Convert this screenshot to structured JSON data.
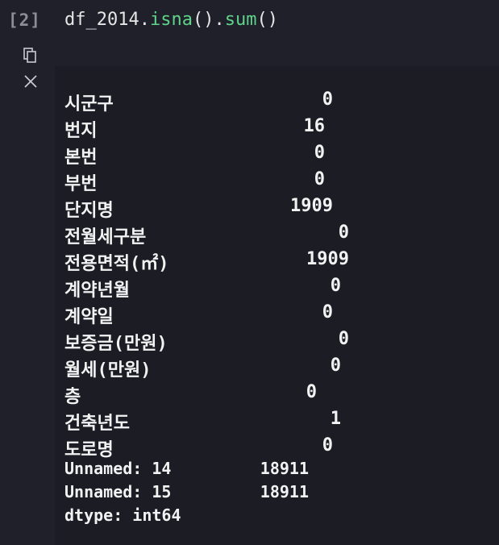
{
  "cell": {
    "prompt": "[2]",
    "code": {
      "obj": "df_2014.",
      "fn1": "isna",
      "mid": "().",
      "fn2": "sum",
      "end": "()"
    }
  },
  "output": {
    "rows": [
      {
        "label": "시군구",
        "value": "0"
      },
      {
        "label": "번지",
        "value": "16"
      },
      {
        "label": "본번",
        "value": "0"
      },
      {
        "label": "부번",
        "value": "0"
      },
      {
        "label": "단지명",
        "value": "1909"
      },
      {
        "label": "전월세구분",
        "value": "0"
      },
      {
        "label": "전용면적(㎡)",
        "value": "1909"
      },
      {
        "label": "계약년월",
        "value": "0"
      },
      {
        "label": "계약일",
        "value": "0"
      },
      {
        "label": "보증금(만원)",
        "value": "0"
      },
      {
        "label": "월세(만원)",
        "value": "0"
      },
      {
        "label": "층",
        "value": "0"
      },
      {
        "label": "건축년도",
        "value": "1"
      },
      {
        "label": "도로명",
        "value": "0"
      },
      {
        "label": "Unnamed: 14",
        "value": "18911"
      },
      {
        "label": "Unnamed: 15",
        "value": "18911"
      }
    ],
    "dtype": "dtype: int64"
  },
  "icons": {
    "copy": "copy-icon",
    "clear": "close-icon"
  }
}
